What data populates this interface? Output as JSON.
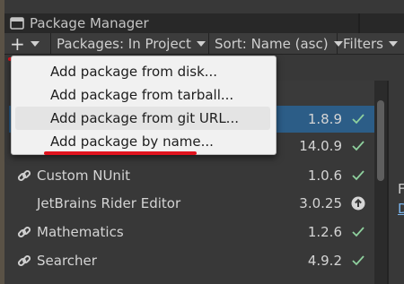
{
  "window": {
    "title": "Package Manager"
  },
  "toolbar": {
    "add_button_label": "+",
    "packages_filter": "Packages: In Project",
    "sort": "Sort: Name (asc)",
    "filters": "Filters"
  },
  "add_menu": {
    "items": [
      {
        "label": "Add package from disk..."
      },
      {
        "label": "Add package from tarball..."
      },
      {
        "label": "Add package from git URL..."
      },
      {
        "label": "Add package by name..."
      }
    ]
  },
  "packages": {
    "rows": [
      {
        "name": "",
        "version": "1.8.9",
        "status": "installed",
        "selected": true
      },
      {
        "name": "",
        "version": "14.0.9",
        "status": "installed"
      },
      {
        "name": "Custom NUnit",
        "version": "1.0.6",
        "status": "installed",
        "dependency": true
      },
      {
        "name": "JetBrains Rider Editor",
        "version": "3.0.25",
        "status": "update-available"
      },
      {
        "name": "Mathematics",
        "version": "1.2.6",
        "status": "installed",
        "dependency": true
      },
      {
        "name": "Searcher",
        "version": "4.9.2",
        "status": "installed",
        "dependency": true
      }
    ]
  },
  "details_panel": {
    "fragment_1": "F",
    "fragment_2": "D"
  },
  "colors": {
    "annotation_red": "#e0141f",
    "selection_blue": "#2c5d87",
    "check_green": "#8fd19e"
  }
}
